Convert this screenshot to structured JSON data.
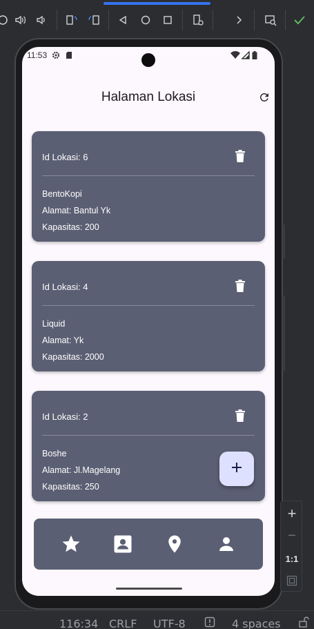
{
  "ide": {
    "toolbar_icons": [
      "volume-up-icon",
      "volume-down-icon",
      "rotate-left-icon",
      "rotate-right-icon",
      "back-icon",
      "home-icon",
      "overview-icon",
      "device-settings-icon",
      "chevron-right-icon",
      "screenshot-icon",
      "check-icon"
    ],
    "side_tools": {
      "zoom_in": "+",
      "zoom_out": "−",
      "ratio": "1:1"
    },
    "status": {
      "position": "116:34",
      "line_ending": "CRLF",
      "encoding": "UTF-8",
      "indent": "4 spaces"
    }
  },
  "phone": {
    "status_bar": {
      "time": "11:53"
    },
    "app_bar": {
      "title": "Halaman Lokasi",
      "refresh_icon": "refresh-icon"
    },
    "locations": [
      {
        "id_label": "Id Lokasi: 6",
        "name": "BentoKopi",
        "address": "Alamat: Bantul Yk",
        "capacity": "Kapasitas: 200"
      },
      {
        "id_label": "Id Lokasi: 4",
        "name": "Liquid",
        "address": "Alamat: Yk",
        "capacity": "Kapasitas: 2000"
      },
      {
        "id_label": "Id Lokasi: 2",
        "name": "Boshe",
        "address": "Alamat: Jl.Magelang",
        "capacity": "Kapasitas: 250"
      }
    ],
    "fab": {
      "label": "+"
    },
    "bottom_nav": [
      "star-icon",
      "contact-card-icon",
      "location-pin-icon",
      "person-icon"
    ]
  },
  "colors": {
    "card": "#5b5f73",
    "fab": "#dde1ff",
    "accent": "#3574f0",
    "screen": "#fdf8fd"
  }
}
